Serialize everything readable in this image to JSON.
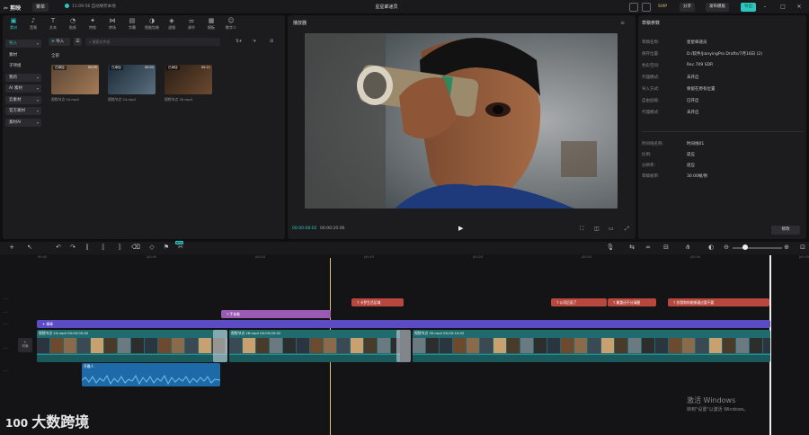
{
  "app": {
    "logo": "✂ 剪映",
    "menu": "菜单",
    "autosave": "11:09:56 自动保存本地",
    "title": "星星邮递员"
  },
  "top_buttons": {
    "svip": "SVIP",
    "share": "分享",
    "publish_draft": "发布模板",
    "export": "导出"
  },
  "left_tabs": [
    {
      "icon": "▣",
      "label": "素材",
      "name": "tab-media"
    },
    {
      "icon": "♪",
      "label": "音频",
      "name": "tab-audio"
    },
    {
      "icon": "T",
      "label": "文本",
      "name": "tab-text"
    },
    {
      "icon": "◔",
      "label": "贴纸",
      "name": "tab-sticker"
    },
    {
      "icon": "✦",
      "label": "特效",
      "name": "tab-effects"
    },
    {
      "icon": "⋈",
      "label": "转场",
      "name": "tab-transition"
    },
    {
      "icon": "▤",
      "label": "字幕",
      "name": "tab-captions"
    },
    {
      "icon": "◑",
      "label": "智能包装",
      "name": "tab-smart-pack"
    },
    {
      "icon": "◈",
      "label": "滤镜",
      "name": "tab-filters"
    },
    {
      "icon": "⚌",
      "label": "调节",
      "name": "tab-adjust"
    },
    {
      "icon": "▦",
      "label": "模板",
      "name": "tab-templates"
    },
    {
      "icon": "☺",
      "label": "数字人",
      "name": "tab-avatar"
    }
  ],
  "sidebar": [
    {
      "label": "导入",
      "pill": true
    },
    {
      "label": "素材",
      "pill": false
    },
    {
      "label": "子项组",
      "pill": false
    },
    {
      "label": "我的",
      "pill": true
    },
    {
      "label": "AI 素材",
      "pill": true
    },
    {
      "label": "云素材",
      "pill": true
    },
    {
      "label": "官方素材",
      "pill": true
    },
    {
      "label": "素材AI",
      "pill": true
    }
  ],
  "media_toolbar": {
    "import": "导入",
    "search_placeholder": "搜索文件名",
    "section": "全部"
  },
  "media": [
    {
      "badge": "已添加",
      "duration": "00:05",
      "label": "视频节点 24.mp4",
      "name": "media-item-24"
    },
    {
      "badge": "已添加",
      "duration": "00:04",
      "label": "视频节点 24.mp4",
      "name": "media-item-24b"
    },
    {
      "badge": "已添加",
      "duration": "00:11",
      "label": "视频节点 30.mp4",
      "name": "media-item-30"
    }
  ],
  "player": {
    "title": "播放器",
    "current": "00:00:08:02",
    "total": "00:00:20:06"
  },
  "draft": {
    "title": "草稿参数",
    "rows": [
      {
        "k": "草稿名称:",
        "v": "星星邮递员"
      },
      {
        "k": "保存位置:",
        "v": "D:/软件/JianyingPro Drafts/7月16日 (2)"
      },
      {
        "k": "色彩空间:",
        "v": "Rec.709 SDR"
      },
      {
        "k": "代理模式:",
        "v": "未开启"
      },
      {
        "k": "导入方式:",
        "v": "保留在原有位置"
      },
      {
        "k": "自由层级:",
        "v": "已开启"
      },
      {
        "k": "代理模式:",
        "v": "未开启"
      }
    ],
    "rows2": [
      {
        "k": "时间线名称:",
        "v": "时间线01"
      },
      {
        "k": "比例:",
        "v": "适应"
      },
      {
        "k": "分辨率:",
        "v": "适应"
      },
      {
        "k": "草稿帧率:",
        "v": "30.00帧/秒"
      }
    ],
    "modify": "修改"
  },
  "ruler": [
    "00:00",
    "|00:05",
    "|00:10",
    "|00:15",
    "|00:20",
    "|00:25",
    "|00:30",
    "|00:35"
  ],
  "timeline": {
    "text_clips": [
      "T 卡罗生活区域",
      "T 公司后面了",
      "T 最重还不分清醒",
      "T 扶我和你能够通过要不要"
    ],
    "sticker_clip": "T 手拿着",
    "effect_clip": "✦ 棒棒",
    "video_clips": [
      {
        "label": "视频节点 24.mp4  00:00:05:02"
      },
      {
        "label": "视频节点 26.mp4  00:00:05:02"
      },
      {
        "label": "视频节点 30.mp4  00:00:10:02"
      }
    ],
    "cover": "封面",
    "audio_clip": "开最人"
  },
  "watermark": {
    "activate1": "激活 Windows",
    "activate2": "转到\"设置\"以激活 Windows。",
    "brand": "大数跨境"
  },
  "colors": {
    "accent": "#2ec4c4",
    "text_clip": "#b8483e",
    "sticker_clip": "#9b5bb5",
    "effect_track": "#5b4bc4",
    "video_track": "#1f6b6e",
    "audio_track": "#1e6aa8"
  }
}
